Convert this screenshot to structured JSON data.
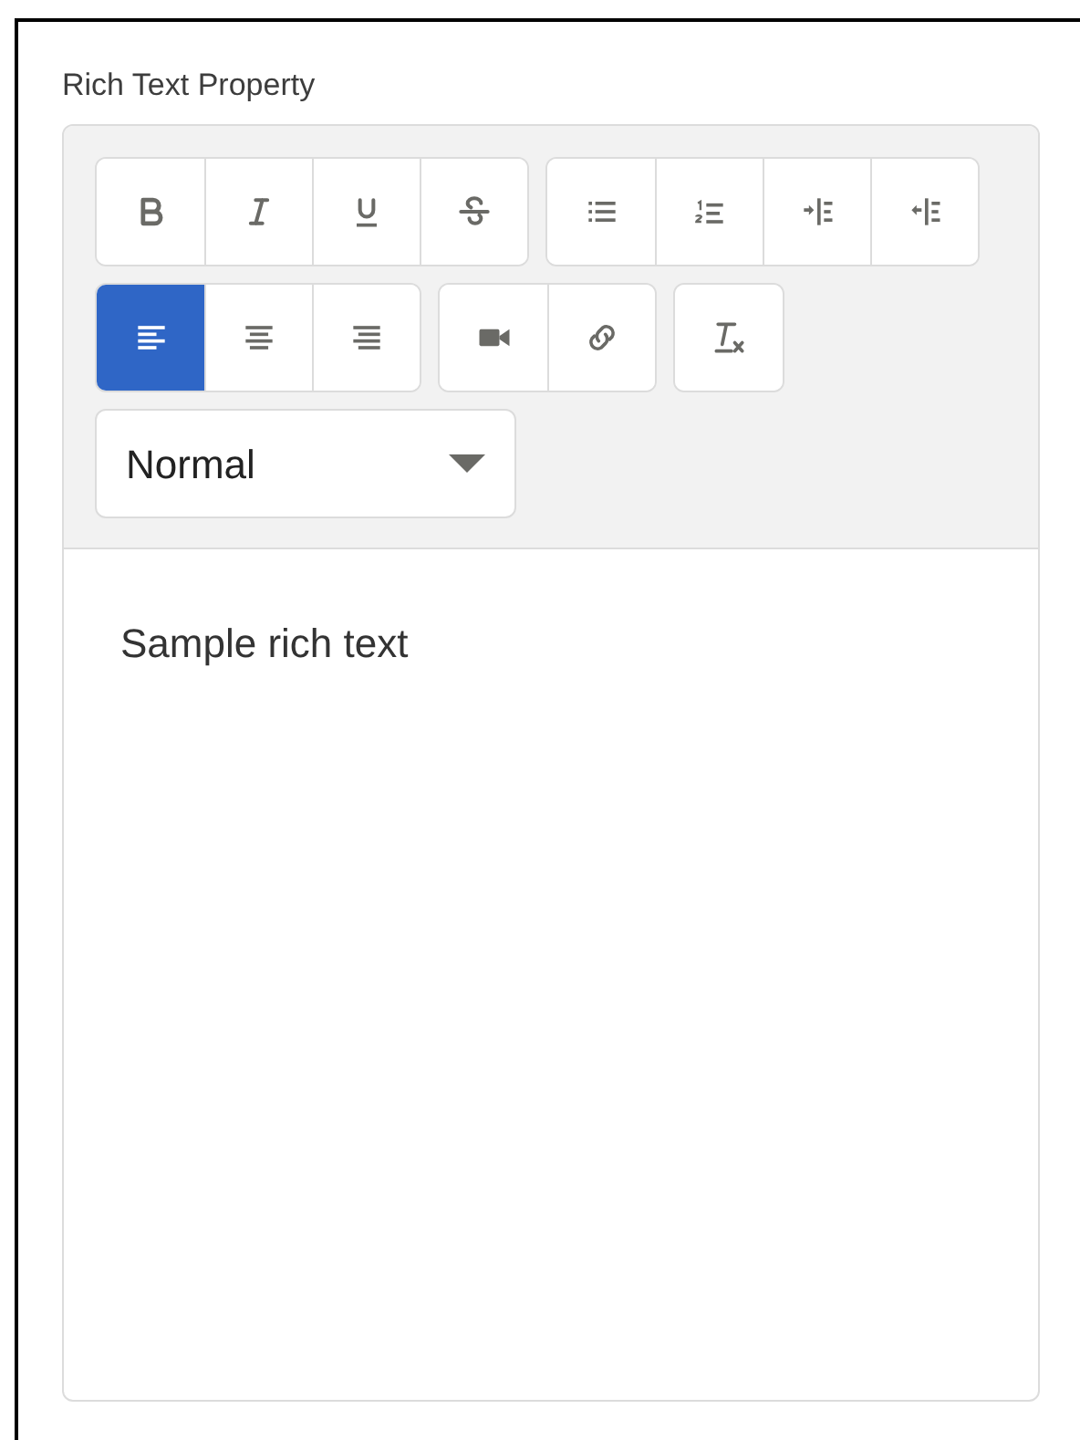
{
  "label": "Rich Text Property",
  "toolbar": {
    "rows": [
      [
        {
          "buttons": [
            {
              "kind": "bold",
              "selected": false
            },
            {
              "kind": "italic",
              "selected": false
            },
            {
              "kind": "underline",
              "selected": false
            },
            {
              "kind": "strike",
              "selected": false
            }
          ]
        },
        {
          "buttons": [
            {
              "kind": "bullet-list",
              "selected": false
            },
            {
              "kind": "ordered-list",
              "selected": false
            },
            {
              "kind": "indent",
              "selected": false
            },
            {
              "kind": "outdent",
              "selected": false
            }
          ]
        }
      ],
      [
        {
          "buttons": [
            {
              "kind": "align-left",
              "selected": true
            },
            {
              "kind": "align-center",
              "selected": false
            },
            {
              "kind": "align-right",
              "selected": false
            }
          ]
        },
        {
          "buttons": [
            {
              "kind": "video",
              "selected": false
            },
            {
              "kind": "link",
              "selected": false
            }
          ]
        },
        {
          "buttons": [
            {
              "kind": "clear-format",
              "selected": false
            }
          ]
        }
      ]
    ],
    "format_select": {
      "value": "Normal"
    }
  },
  "content": "Sample rich text"
}
